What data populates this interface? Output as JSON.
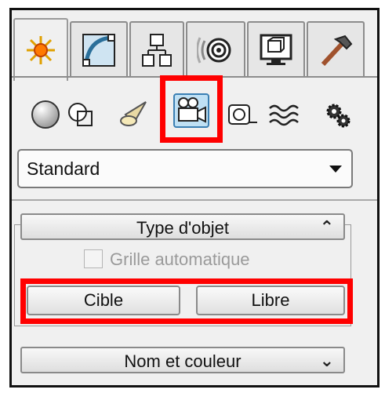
{
  "tabs": [
    {
      "name": "create-tab",
      "icon": "sun-star-icon",
      "active": true
    },
    {
      "name": "modify-tab",
      "icon": "curve-modify-icon",
      "active": false
    },
    {
      "name": "hierarchy-tab",
      "icon": "hierarchy-icon",
      "active": false
    },
    {
      "name": "motion-tab",
      "icon": "motion-rings-icon",
      "active": false
    },
    {
      "name": "display-tab",
      "icon": "monitor-icon",
      "active": false
    },
    {
      "name": "utilities-tab",
      "icon": "hammer-icon",
      "active": false
    }
  ],
  "categories": [
    {
      "name": "geometry",
      "icon": "sphere-icon"
    },
    {
      "name": "shapes",
      "icon": "shapes-icon"
    },
    {
      "name": "lights",
      "icon": "light-icon"
    },
    {
      "name": "cameras",
      "icon": "camera-icon",
      "selected": true
    },
    {
      "name": "helpers",
      "icon": "tape-measure-icon"
    },
    {
      "name": "space-warps",
      "icon": "waves-icon"
    },
    {
      "name": "systems",
      "icon": "gears-icon"
    }
  ],
  "dropdown": {
    "value": "Standard"
  },
  "rollout_type": {
    "title": "Type d'objet",
    "checkbox_label": "Grille automatique",
    "checkbox_checked": false,
    "buttons": [
      "Cible",
      "Libre"
    ]
  },
  "rollout_name": {
    "title": "Nom et couleur"
  },
  "colors": {
    "highlight": "#ff0000",
    "panel": "#f0f0f0"
  }
}
